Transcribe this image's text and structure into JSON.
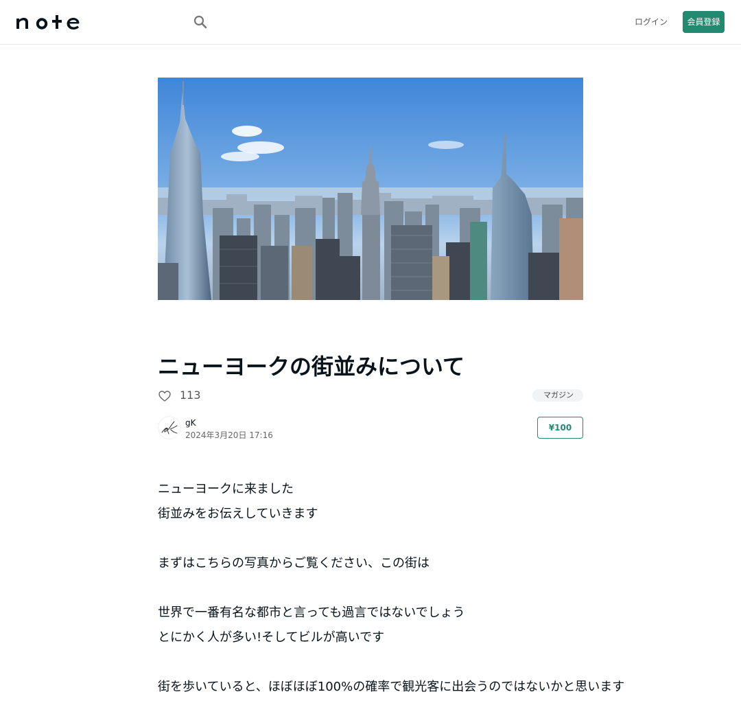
{
  "header": {
    "logo_text": "note",
    "search_icon": "search-icon",
    "login_label": "ログイン",
    "signup_label": "会員登録"
  },
  "hero": {
    "icon": "city-skyline-image"
  },
  "article": {
    "title": "ニューヨークの街並みについて",
    "like_icon": "heart-icon",
    "like_count": "113",
    "tag": "マガジン",
    "author": {
      "name": "gK",
      "avatar_icon": "signature-avatar"
    },
    "date": "2024年3月20日 17:16",
    "price": "¥100",
    "body_lines": [
      "ニューヨークに来ました",
      "街並みをお伝えしていきます",
      "",
      "まずはこちらの写真からご覧ください、この街は",
      "",
      "世界で一番有名な都市と言っても過言ではないでしょう",
      "とにかく人が多い!そしてビルが高いです",
      "",
      "街を歩いていると、ほぼほぼ100%の確率で観光客に出会うのではないかと思います"
    ]
  },
  "colors": {
    "brand_green": "#228a6f",
    "text": "#08131a",
    "border": "#e6e6e6"
  }
}
